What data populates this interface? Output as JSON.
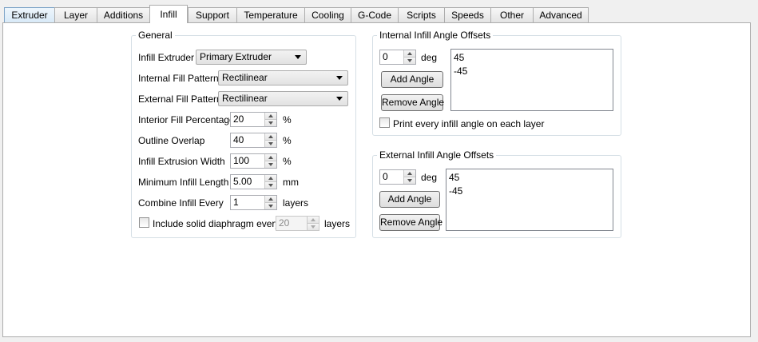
{
  "tabs": [
    {
      "label": "Extruder"
    },
    {
      "label": "Layer"
    },
    {
      "label": "Additions"
    },
    {
      "label": "Infill"
    },
    {
      "label": "Support"
    },
    {
      "label": "Temperature"
    },
    {
      "label": "Cooling"
    },
    {
      "label": "G-Code"
    },
    {
      "label": "Scripts"
    },
    {
      "label": "Speeds"
    },
    {
      "label": "Other"
    },
    {
      "label": "Advanced"
    }
  ],
  "active_tab": "Infill",
  "general": {
    "title": "General",
    "infill_extruder": {
      "label": "Infill Extruder",
      "value": "Primary Extruder"
    },
    "internal_fill_pattern": {
      "label": "Internal Fill Pattern",
      "value": "Rectilinear"
    },
    "external_fill_pattern": {
      "label": "External Fill Pattern",
      "value": "Rectilinear"
    },
    "interior_fill_percentage": {
      "label": "Interior Fill Percentage",
      "value": "20",
      "unit": "%"
    },
    "outline_overlap": {
      "label": "Outline Overlap",
      "value": "40",
      "unit": "%"
    },
    "infill_extrusion_width": {
      "label": "Infill Extrusion Width",
      "value": "100",
      "unit": "%"
    },
    "minimum_infill_length": {
      "label": "Minimum Infill Length",
      "value": "5.00",
      "unit": "mm"
    },
    "combine_infill_every": {
      "label": "Combine Infill Every",
      "value": "1",
      "unit": "layers"
    },
    "solid_diaphragm": {
      "label": "Include solid diaphragm every",
      "value": "20",
      "unit": "layers",
      "checked": false
    }
  },
  "internal_offsets": {
    "title": "Internal Infill Angle Offsets",
    "angle_value": "0",
    "unit": "deg",
    "add_label": "Add Angle",
    "remove_label": "Remove Angle",
    "angles": [
      "45",
      "-45"
    ],
    "print_every_label": "Print every infill angle on each layer",
    "print_every_checked": false
  },
  "external_offsets": {
    "title": "External Infill Angle Offsets",
    "angle_value": "0",
    "unit": "deg",
    "add_label": "Add Angle",
    "remove_label": "Remove Angle",
    "angles": [
      "45",
      "-45"
    ]
  }
}
